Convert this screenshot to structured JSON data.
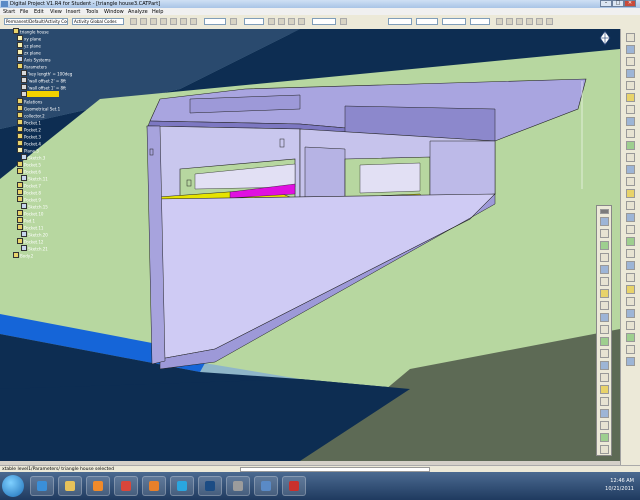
{
  "window": {
    "title": "Digital Project V1.R4 for Student - [triangle house3.CATPart]",
    "min_label": "–",
    "max_label": "□",
    "close_label": "✕"
  },
  "menu": {
    "items": [
      "Start",
      "File",
      "Edit",
      "View",
      "Insert",
      "Tools",
      "Window",
      "Analyze",
      "Help"
    ]
  },
  "toolbar": {
    "left_dropdown": "Permanent/Default/Activity Codes",
    "right_dropdown": "Activity Global Codes"
  },
  "tree": {
    "items": [
      "triangle house",
      "xy plane",
      "yz plane",
      "zx plane",
      "Axis Systems",
      "Parameters",
      "'key length' = 100deg",
      "'wall offset 2' = 8ft",
      "'wall offset 1' = 8ft",
      "",
      "Relations",
      "Geometrical Set.1",
      "collector.2",
      "Pocket.1",
      "Pocket.2",
      "Pocket.3",
      "Pocket.4",
      "Plane.3",
      "Sketch.3",
      "Pocket.5",
      "Pocket.6",
      "Sketch.11",
      "Pocket.7",
      "Pocket.8",
      "Pocket.9",
      "Sketch.15",
      "Pocket.10",
      "Pad.1",
      "Pocket.11",
      "Sketch.20",
      "Pocket.12",
      "Sketch.21",
      "Body.2"
    ]
  },
  "status": {
    "text": "xtable level1/Parameters/ triangle house selected"
  },
  "clock": {
    "time": "12:46 AM",
    "date": "10/21/2011"
  },
  "icons": {
    "start": "windows-start-icon",
    "compass": "compass-icon"
  }
}
